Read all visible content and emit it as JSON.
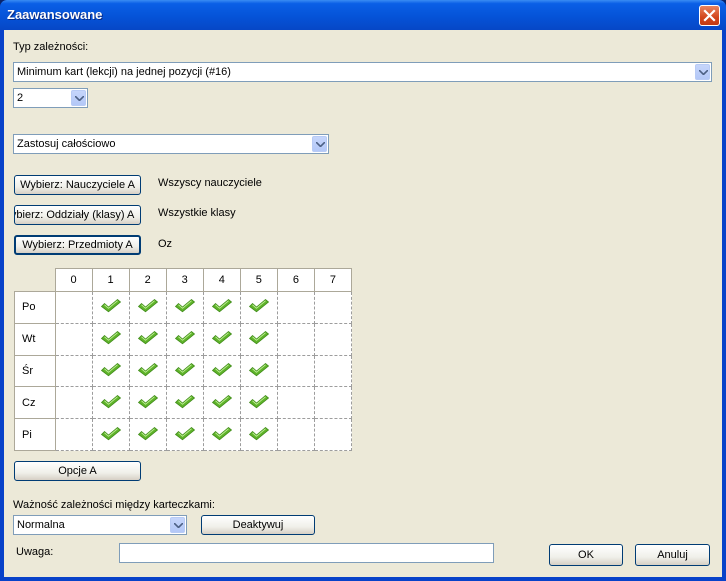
{
  "window": {
    "title": "Zaawansowane"
  },
  "dependency": {
    "type_label": "Typ zależności:",
    "type_value": "Minimum kart (lekcji) na jednej pozycji (#16)",
    "count_value": "2"
  },
  "apply": {
    "value": "Zastosuj całościowo"
  },
  "selectors": [
    {
      "button": "Wybierz: Nauczyciele A",
      "value": "Wszyscy nauczyciele"
    },
    {
      "button": "Wybierz: Oddziały (klasy) A",
      "value": "Wszystkie klasy"
    },
    {
      "button": "Wybierz: Przedmioty A",
      "value": "Oz"
    }
  ],
  "grid": {
    "columns": [
      "0",
      "1",
      "2",
      "3",
      "4",
      "5",
      "6",
      "7"
    ],
    "rows": [
      {
        "label": "Po",
        "checked": [
          false,
          true,
          true,
          true,
          true,
          true,
          false,
          false
        ]
      },
      {
        "label": "Wt",
        "checked": [
          false,
          true,
          true,
          true,
          true,
          true,
          false,
          false
        ]
      },
      {
        "label": "Śr",
        "checked": [
          false,
          true,
          true,
          true,
          true,
          true,
          false,
          false
        ]
      },
      {
        "label": "Cz",
        "checked": [
          false,
          true,
          true,
          true,
          true,
          true,
          false,
          false
        ]
      },
      {
        "label": "Pi",
        "checked": [
          false,
          true,
          true,
          true,
          true,
          true,
          false,
          false
        ]
      }
    ],
    "check_icon": "checkmark-icon",
    "check_color": "#5fb32a"
  },
  "options_button": "Opcje A",
  "importance": {
    "label": "Ważność zależności między karteczkami:",
    "value": "Normalna",
    "deactivate_button": "Deaktywuj"
  },
  "note": {
    "label": "Uwaga:",
    "value": ""
  },
  "footer": {
    "ok": "OK",
    "cancel": "Anuluj"
  }
}
